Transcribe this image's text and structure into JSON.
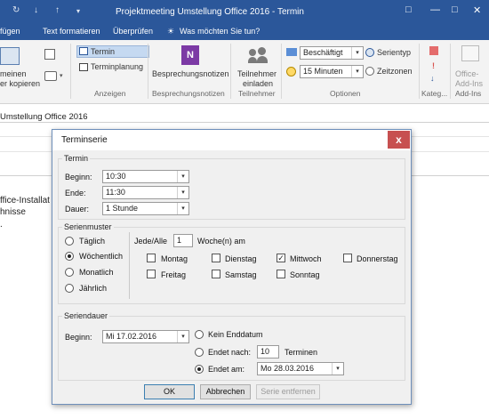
{
  "titlebar": {
    "title": "Projektmeeting Umstellung Office 2016 - Termin",
    "undo_icon": "undo-arrow-icon",
    "redo_icon": "down-arrow-icon",
    "window_buttons": [
      "restore-icon",
      "minimize-icon",
      "maximize-icon",
      "close-icon"
    ]
  },
  "tabs": [
    "fügen",
    "Text formatieren",
    "Überprüfen",
    "Was möchten Sie tun?"
  ],
  "tell_me_icon": "lightbulb-icon",
  "ribbon": {
    "copy_meeting": {
      "line1": "meinen",
      "line2": "er kopieren"
    },
    "anzeigen": {
      "termin": "Termin",
      "terminplanung": "Terminplanung",
      "group": "Anzeigen"
    },
    "besprechungsnotizen": {
      "label": "Besprechungsnotizen",
      "group": "Besprechungsnotizen"
    },
    "teilnehmer": {
      "line1": "Teilnehmer",
      "line2": "einladen",
      "group": "Teilnehmer"
    },
    "optionen": {
      "status": "Beschäftigt",
      "reminder": "15 Minuten",
      "serientyp": "Serientyp",
      "zeitzonen": "Zeitzonen",
      "group": "Optionen"
    },
    "kateg": {
      "group": "Kateg..."
    },
    "addins": {
      "line1": "Office-",
      "line2": "Add-Ins",
      "group": "Add-Ins"
    }
  },
  "subject": "Umstellung Office 2016",
  "body_text": [
    "ffice-Installat",
    "hnisse"
  ],
  "dialog": {
    "title": "Terminserie",
    "termin": {
      "legend": "Termin",
      "beginn_label": "Beginn:",
      "beginn_value": "10:30",
      "ende_label": "Ende:",
      "ende_value": "11:30",
      "dauer_label": "Dauer:",
      "dauer_value": "1 Stunde"
    },
    "muster": {
      "legend": "Serienmuster",
      "options": [
        "Täglich",
        "Wöchentlich",
        "Monatlich",
        "Jährlich"
      ],
      "selected": "Wöchentlich",
      "jede_label": "Jede/Alle",
      "interval": "1",
      "wochen_label": "Woche(n) am",
      "days": [
        {
          "label": "Montag",
          "checked": false
        },
        {
          "label": "Dienstag",
          "checked": false
        },
        {
          "label": "Mittwoch",
          "checked": true
        },
        {
          "label": "Donnerstag",
          "checked": false
        },
        {
          "label": "Freitag",
          "checked": false
        },
        {
          "label": "Samstag",
          "checked": false
        },
        {
          "label": "Sonntag",
          "checked": false
        }
      ]
    },
    "dauer": {
      "legend": "Seriendauer",
      "beginn_label": "Beginn:",
      "beginn_value": "Mi 17.02.2016",
      "kein_enddatum": "Kein Enddatum",
      "endet_nach": "Endet nach:",
      "count": "10",
      "termine_label": "Terminen",
      "endet_am": "Endet am:",
      "end_date": "Mo 28.03.2016",
      "selected": "Endet am:"
    },
    "buttons": {
      "ok": "OK",
      "abbrechen": "Abbrechen",
      "entfernen": "Serie entfernen"
    },
    "close_glyph": "x"
  },
  "colors": {
    "accent": "#2b579a",
    "dialog_bg": "#f0f0f0",
    "close": "#c75050"
  }
}
